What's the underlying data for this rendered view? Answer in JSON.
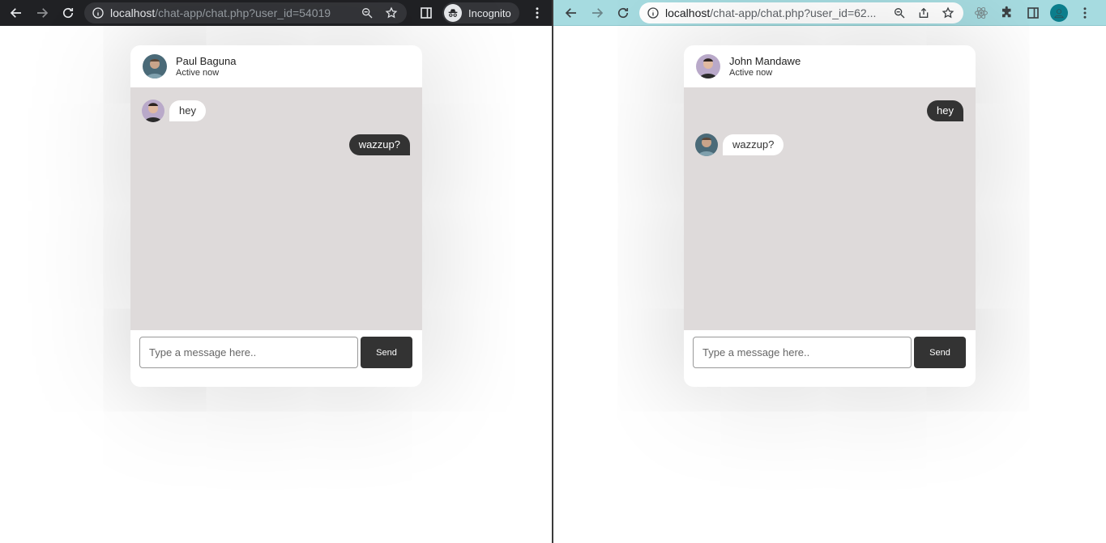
{
  "left_window": {
    "url_host": "localhost",
    "url_path": "/chat-app/chat.php?user_id=54019",
    "incognito_label": "Incognito",
    "chat": {
      "name": "Paul Baguna",
      "status": "Active now",
      "messages": [
        {
          "direction": "incoming",
          "text": "hey"
        },
        {
          "direction": "outgoing",
          "text": "wazzup?"
        }
      ],
      "input_placeholder": "Type a message here..",
      "send_label": "Send"
    }
  },
  "right_window": {
    "url_host": "localhost",
    "url_path": "/chat-app/chat.php?user_id=62...",
    "chat": {
      "name": "John Mandawe",
      "status": "Active now",
      "messages": [
        {
          "direction": "outgoing",
          "text": "hey"
        },
        {
          "direction": "incoming",
          "text": "wazzup?"
        }
      ],
      "input_placeholder": "Type a message here..",
      "send_label": "Send"
    }
  },
  "colors": {
    "dark_toolbar": "#202124",
    "light_toolbar": "#a6dbe0",
    "chat_background": "#dedada",
    "outgoing_bubble": "#333333",
    "send_button": "#333333"
  },
  "icons": [
    "back-arrow-icon",
    "forward-arrow-icon",
    "reload-icon",
    "info-icon",
    "zoom-icon",
    "star-icon",
    "share-icon",
    "side-panel-icon",
    "incognito-icon",
    "extensions-icon",
    "react-devtools-icon",
    "profile-icon",
    "more-icon"
  ]
}
